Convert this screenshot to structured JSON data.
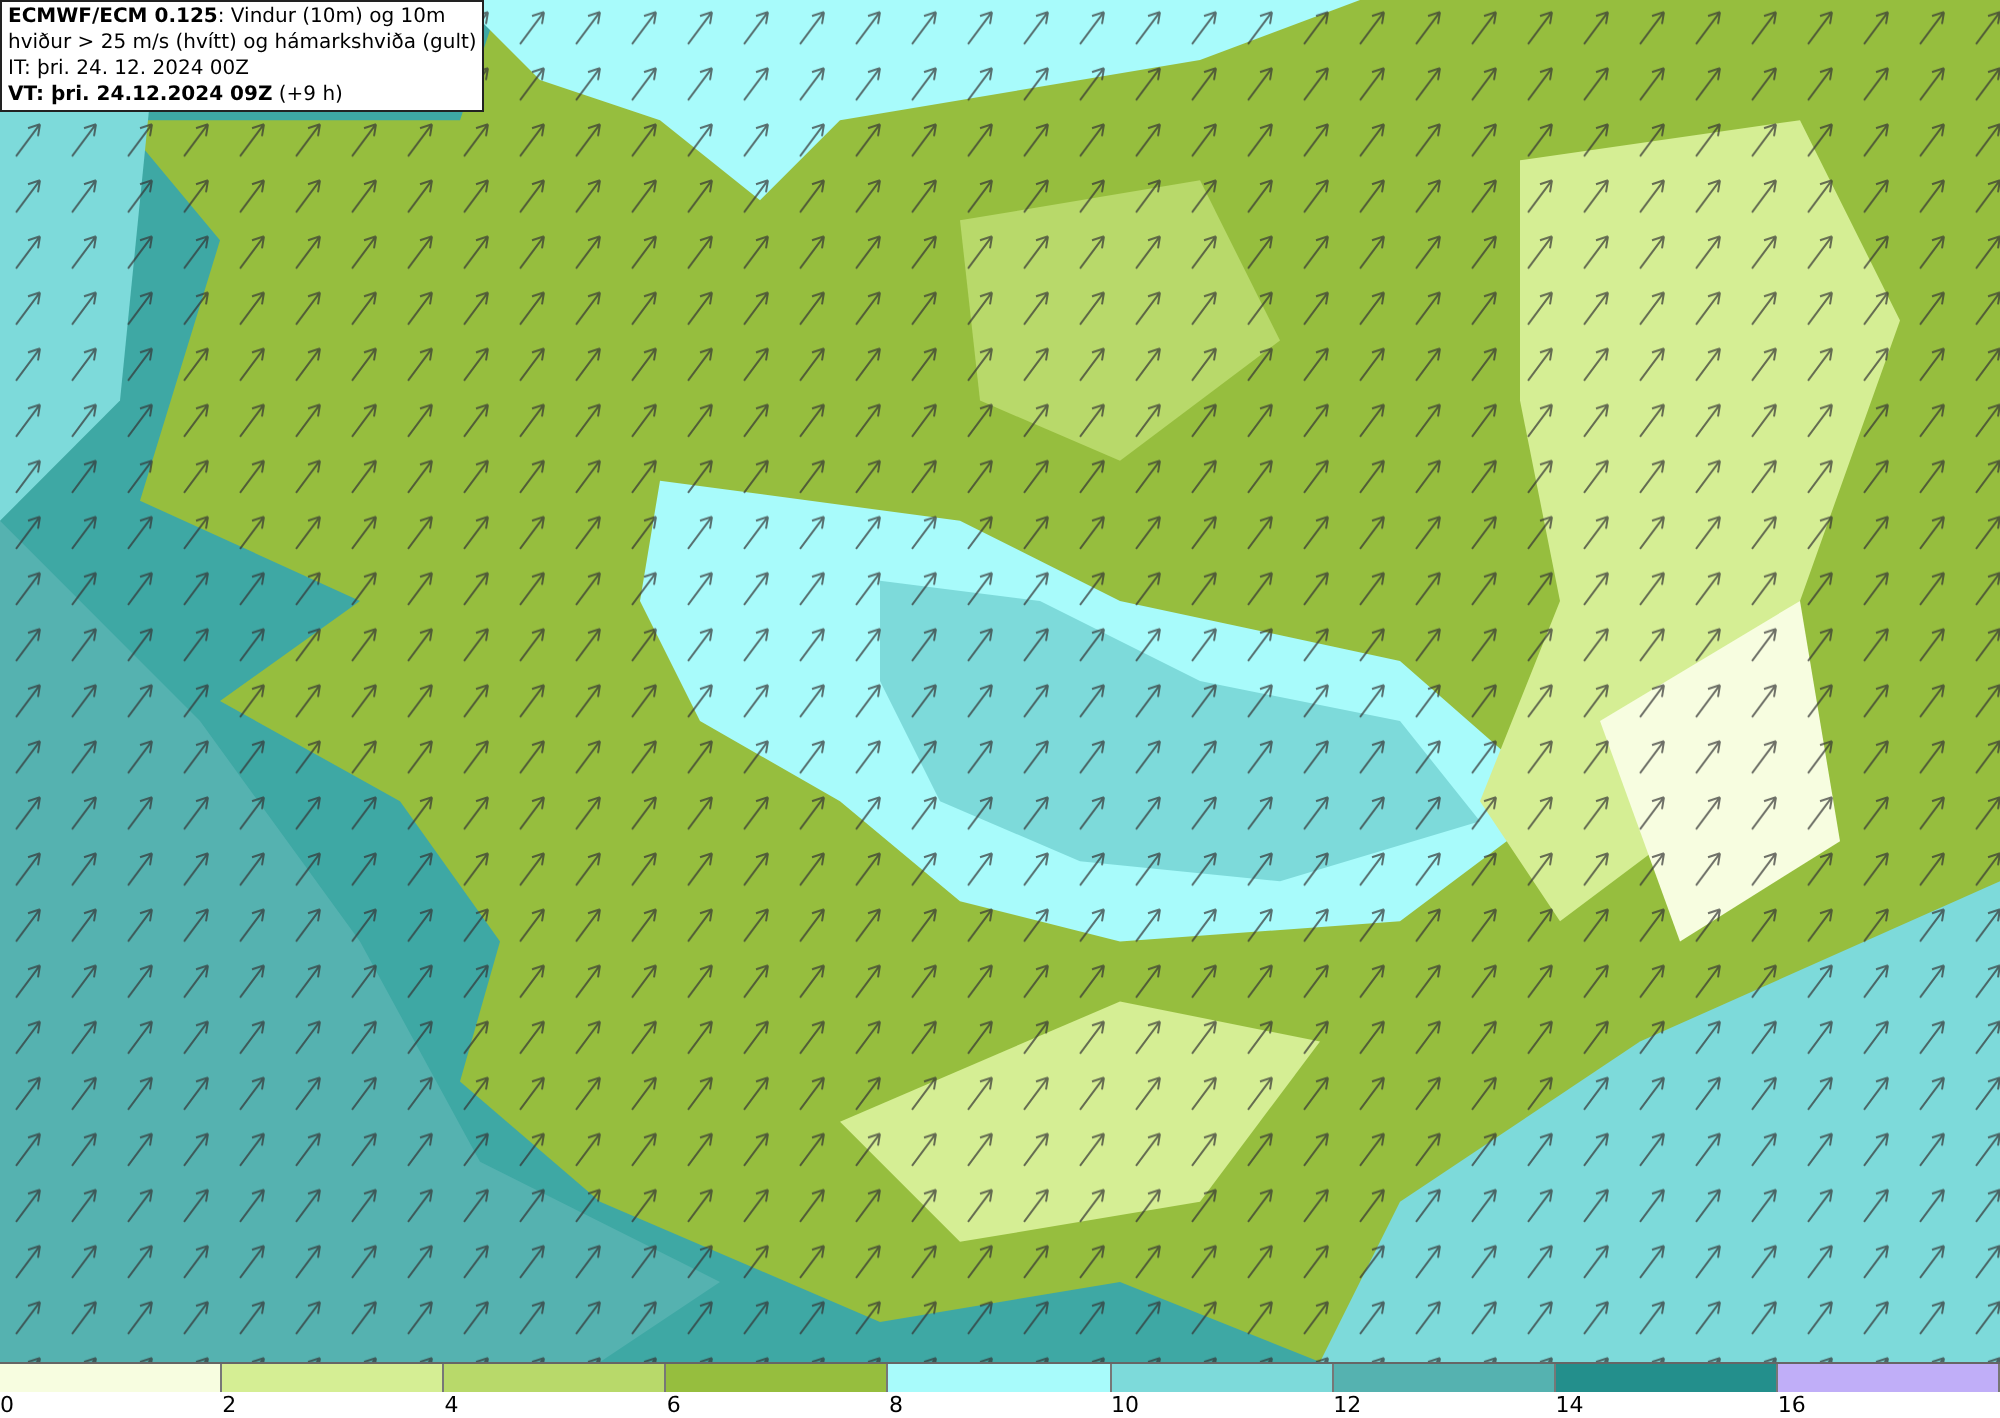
{
  "title_box": {
    "lines": [
      "**ECMWF/ECM 0.125**: Vindur (10m) og 10m",
      "hviður > 25 m/s (hvítt) og hámarkshviða (gult)",
      "IT: þri. 24. 12. 2024 00Z",
      "**VT: þri. 24.12.2024 09Z** (+9 h)"
    ]
  },
  "legend": [
    {
      "color": "#f7fde0",
      "tick": "0"
    },
    {
      "color": "#d5ee94",
      "tick": "2"
    },
    {
      "color": "#b8d96a",
      "tick": "4"
    },
    {
      "color": "#96be3e",
      "tick": "6"
    },
    {
      "color": "#a8fbfb",
      "tick": "8"
    },
    {
      "color": "#7ddada",
      "tick": "10"
    },
    {
      "color": "#55b2b0",
      "tick": "12"
    },
    {
      "color": "#238f8c",
      "tick": "14"
    },
    {
      "color": "#c0aef8",
      "tick": "16"
    }
  ]
}
